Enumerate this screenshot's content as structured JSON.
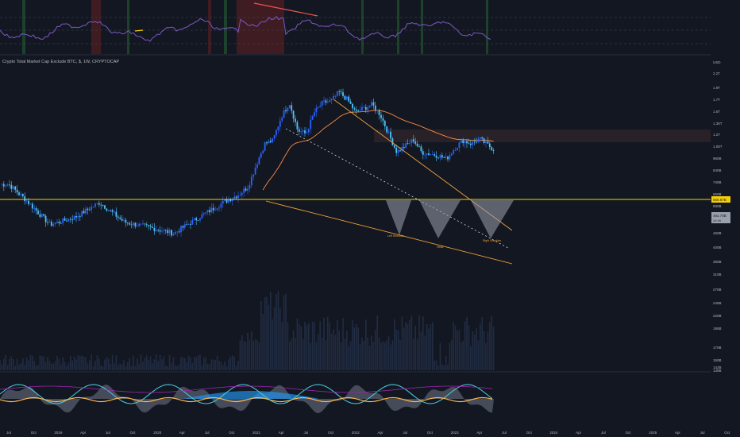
{
  "chart_data": {
    "type": "candlestick",
    "title": "Crypto Total Market Cap Exclude BTC, $, 1W, CRYPTOCAP",
    "currency": "USD",
    "price_axis": {
      "scale": "log",
      "ylim": [
        1250000000,
        2400000000000
      ],
      "ticks": [
        "2.2T",
        "1.9T",
        "1.7T",
        "1.5T",
        "1.35T",
        "1.2T",
        "1.08T",
        "960B",
        "840B",
        "740B",
        "650B",
        "580B",
        "510B",
        "450B",
        "400B",
        "350B",
        "310B",
        "270B",
        "245B",
        "220B",
        "195B",
        "170B",
        "150B",
        "142B",
        "130B"
      ]
    },
    "price_labels": {
      "level": "556.67B",
      "last": "492.70B",
      "countdown": "2d 4h"
    },
    "horizontal_level": 556670000000,
    "annotations": [
      "Left Shoulder",
      "Head",
      "Right Shoulder"
    ],
    "time_axis": [
      "Jul",
      "Oct",
      "2019",
      "Apr",
      "Jul",
      "Oct",
      "2020",
      "Apr",
      "Jul",
      "Oct",
      "2021",
      "Apr",
      "Jul",
      "Oct",
      "2022",
      "Apr",
      "Jul",
      "Oct",
      "2023",
      "Apr",
      "Jul",
      "Oct",
      "2024",
      "Apr",
      "Jul",
      "Oct",
      "2025",
      "Apr",
      "Jul",
      "Oct"
    ],
    "weekly_close_trend": [
      {
        "date": "2018-07",
        "value": 210000000000
      },
      {
        "date": "2018-09",
        "value": 150000000000
      },
      {
        "date": "2018-12",
        "value": 85000000000
      },
      {
        "date": "2019-03",
        "value": 100000000000
      },
      {
        "date": "2019-06",
        "value": 140000000000
      },
      {
        "date": "2019-09",
        "value": 90000000000
      },
      {
        "date": "2019-12",
        "value": 80000000000
      },
      {
        "date": "2020-03",
        "value": 70000000000
      },
      {
        "date": "2020-06",
        "value": 100000000000
      },
      {
        "date": "2020-09",
        "value": 140000000000
      },
      {
        "date": "2020-11",
        "value": 170000000000
      },
      {
        "date": "2020-12",
        "value": 200000000000
      },
      {
        "date": "2021-01",
        "value": 330000000000
      },
      {
        "date": "2021-02",
        "value": 520000000000
      },
      {
        "date": "2021-03",
        "value": 560000000000
      },
      {
        "date": "2021-04",
        "value": 950000000000
      },
      {
        "date": "2021-05",
        "value": 1300000000000
      },
      {
        "date": "2021-06",
        "value": 700000000000
      },
      {
        "date": "2021-07",
        "value": 650000000000
      },
      {
        "date": "2021-08",
        "value": 1050000000000
      },
      {
        "date": "2021-09",
        "value": 1300000000000
      },
      {
        "date": "2021-10",
        "value": 1350000000000
      },
      {
        "date": "2021-11",
        "value": 1650000000000
      },
      {
        "date": "2021-12",
        "value": 1400000000000
      },
      {
        "date": "2022-01",
        "value": 1050000000000
      },
      {
        "date": "2022-02",
        "value": 1150000000000
      },
      {
        "date": "2022-03",
        "value": 1250000000000
      },
      {
        "date": "2022-04",
        "value": 1000000000000
      },
      {
        "date": "2022-05",
        "value": 650000000000
      },
      {
        "date": "2022-06",
        "value": 430000000000
      },
      {
        "date": "2022-08",
        "value": 570000000000
      },
      {
        "date": "2022-09",
        "value": 430000000000
      },
      {
        "date": "2022-11",
        "value": 400000000000
      },
      {
        "date": "2022-12",
        "value": 370000000000
      },
      {
        "date": "2023-01",
        "value": 470000000000
      },
      {
        "date": "2023-02",
        "value": 560000000000
      },
      {
        "date": "2023-03",
        "value": 520000000000
      },
      {
        "date": "2023-04",
        "value": 580000000000
      },
      {
        "date": "2023-06",
        "value": 440000000000
      },
      {
        "date": "2023-07",
        "value": 492700000000
      }
    ],
    "indicator_top": {
      "levels": [
        "80.00",
        "60.00",
        "40.00",
        "20.00"
      ]
    },
    "indicator_bottom": {
      "levels": [
        "100",
        "50",
        "0",
        "-50",
        "-100"
      ]
    },
    "colors": {
      "up": "#2962ff",
      "down": "#4fc3f7",
      "level": "#f5d000",
      "trend": "#f0a33a",
      "ema": "#ff8a3d",
      "background": "#131722"
    }
  }
}
